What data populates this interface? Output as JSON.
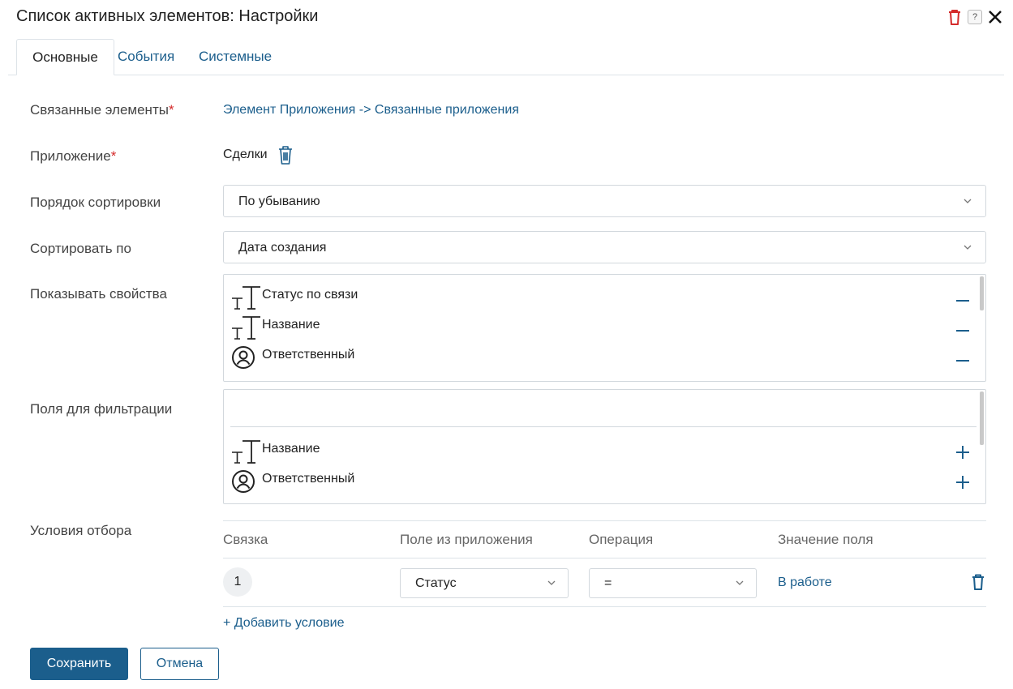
{
  "window": {
    "title": "Список активных элементов: Настройки",
    "icons": [
      "trash-icon",
      "help-icon",
      "close-icon"
    ],
    "colors": {
      "danger": "#d42a2a",
      "accent": "#1b5e8c"
    }
  },
  "tabs": [
    {
      "label": "Основные",
      "active": true
    },
    {
      "label": "События",
      "active": false
    },
    {
      "label": "Системные",
      "active": false
    }
  ],
  "form": {
    "linked": {
      "label": "Связанные элементы",
      "required_mark": "*",
      "value": "Элемент Приложения -> Связанные приложения"
    },
    "app": {
      "label": "Приложение",
      "required_mark": "*",
      "value": "Сделки"
    },
    "sort_order": {
      "label": "Порядок сортировки",
      "value": "По убыванию"
    },
    "sort_by": {
      "label": "Сортировать по",
      "value": "Дата создания"
    },
    "show_props": {
      "label": "Показывать свойства",
      "items": [
        {
          "icon": "text-type-icon",
          "label": "Статус по связи",
          "action": "remove"
        },
        {
          "icon": "text-type-icon",
          "label": "Название",
          "action": "remove"
        },
        {
          "icon": "user-icon",
          "label": "Ответственный",
          "action": "remove"
        }
      ]
    },
    "filter_fields": {
      "label": "Поля для фильтрации",
      "search_value": "",
      "items": [
        {
          "icon": "text-type-icon",
          "label": "Название",
          "action": "add"
        },
        {
          "icon": "user-icon",
          "label": "Ответственный",
          "action": "add"
        }
      ]
    },
    "conditions": {
      "label": "Условия отбора",
      "headers": [
        "Связка",
        "Поле из приложения",
        "Операция",
        "Значение поля"
      ],
      "rows": [
        {
          "index": "1",
          "field": "Статус",
          "operation": "=",
          "value": "В работе"
        }
      ],
      "add_label": "+ Добавить условие"
    }
  },
  "buttons": {
    "save": "Сохранить",
    "cancel": "Отмена"
  }
}
